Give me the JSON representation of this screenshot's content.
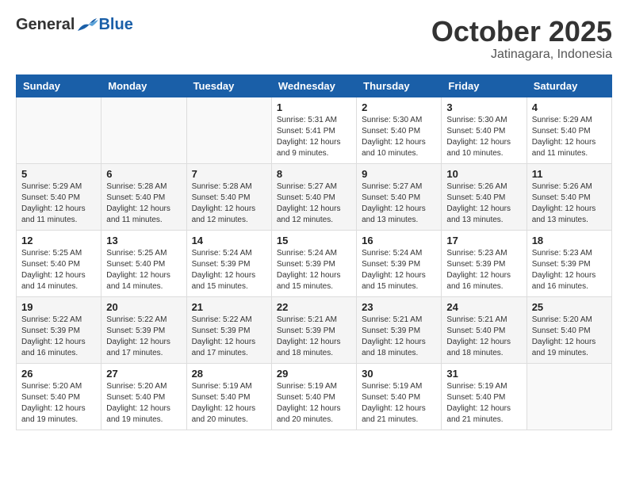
{
  "header": {
    "logo_general": "General",
    "logo_blue": "Blue",
    "month_title": "October 2025",
    "location": "Jatinagara, Indonesia"
  },
  "calendar": {
    "days_of_week": [
      "Sunday",
      "Monday",
      "Tuesday",
      "Wednesday",
      "Thursday",
      "Friday",
      "Saturday"
    ],
    "weeks": [
      [
        {
          "num": "",
          "info": ""
        },
        {
          "num": "",
          "info": ""
        },
        {
          "num": "",
          "info": ""
        },
        {
          "num": "1",
          "info": "Sunrise: 5:31 AM\nSunset: 5:41 PM\nDaylight: 12 hours\nand 9 minutes."
        },
        {
          "num": "2",
          "info": "Sunrise: 5:30 AM\nSunset: 5:40 PM\nDaylight: 12 hours\nand 10 minutes."
        },
        {
          "num": "3",
          "info": "Sunrise: 5:30 AM\nSunset: 5:40 PM\nDaylight: 12 hours\nand 10 minutes."
        },
        {
          "num": "4",
          "info": "Sunrise: 5:29 AM\nSunset: 5:40 PM\nDaylight: 12 hours\nand 11 minutes."
        }
      ],
      [
        {
          "num": "5",
          "info": "Sunrise: 5:29 AM\nSunset: 5:40 PM\nDaylight: 12 hours\nand 11 minutes."
        },
        {
          "num": "6",
          "info": "Sunrise: 5:28 AM\nSunset: 5:40 PM\nDaylight: 12 hours\nand 11 minutes."
        },
        {
          "num": "7",
          "info": "Sunrise: 5:28 AM\nSunset: 5:40 PM\nDaylight: 12 hours\nand 12 minutes."
        },
        {
          "num": "8",
          "info": "Sunrise: 5:27 AM\nSunset: 5:40 PM\nDaylight: 12 hours\nand 12 minutes."
        },
        {
          "num": "9",
          "info": "Sunrise: 5:27 AM\nSunset: 5:40 PM\nDaylight: 12 hours\nand 13 minutes."
        },
        {
          "num": "10",
          "info": "Sunrise: 5:26 AM\nSunset: 5:40 PM\nDaylight: 12 hours\nand 13 minutes."
        },
        {
          "num": "11",
          "info": "Sunrise: 5:26 AM\nSunset: 5:40 PM\nDaylight: 12 hours\nand 13 minutes."
        }
      ],
      [
        {
          "num": "12",
          "info": "Sunrise: 5:25 AM\nSunset: 5:40 PM\nDaylight: 12 hours\nand 14 minutes."
        },
        {
          "num": "13",
          "info": "Sunrise: 5:25 AM\nSunset: 5:40 PM\nDaylight: 12 hours\nand 14 minutes."
        },
        {
          "num": "14",
          "info": "Sunrise: 5:24 AM\nSunset: 5:39 PM\nDaylight: 12 hours\nand 15 minutes."
        },
        {
          "num": "15",
          "info": "Sunrise: 5:24 AM\nSunset: 5:39 PM\nDaylight: 12 hours\nand 15 minutes."
        },
        {
          "num": "16",
          "info": "Sunrise: 5:24 AM\nSunset: 5:39 PM\nDaylight: 12 hours\nand 15 minutes."
        },
        {
          "num": "17",
          "info": "Sunrise: 5:23 AM\nSunset: 5:39 PM\nDaylight: 12 hours\nand 16 minutes."
        },
        {
          "num": "18",
          "info": "Sunrise: 5:23 AM\nSunset: 5:39 PM\nDaylight: 12 hours\nand 16 minutes."
        }
      ],
      [
        {
          "num": "19",
          "info": "Sunrise: 5:22 AM\nSunset: 5:39 PM\nDaylight: 12 hours\nand 16 minutes."
        },
        {
          "num": "20",
          "info": "Sunrise: 5:22 AM\nSunset: 5:39 PM\nDaylight: 12 hours\nand 17 minutes."
        },
        {
          "num": "21",
          "info": "Sunrise: 5:22 AM\nSunset: 5:39 PM\nDaylight: 12 hours\nand 17 minutes."
        },
        {
          "num": "22",
          "info": "Sunrise: 5:21 AM\nSunset: 5:39 PM\nDaylight: 12 hours\nand 18 minutes."
        },
        {
          "num": "23",
          "info": "Sunrise: 5:21 AM\nSunset: 5:39 PM\nDaylight: 12 hours\nand 18 minutes."
        },
        {
          "num": "24",
          "info": "Sunrise: 5:21 AM\nSunset: 5:40 PM\nDaylight: 12 hours\nand 18 minutes."
        },
        {
          "num": "25",
          "info": "Sunrise: 5:20 AM\nSunset: 5:40 PM\nDaylight: 12 hours\nand 19 minutes."
        }
      ],
      [
        {
          "num": "26",
          "info": "Sunrise: 5:20 AM\nSunset: 5:40 PM\nDaylight: 12 hours\nand 19 minutes."
        },
        {
          "num": "27",
          "info": "Sunrise: 5:20 AM\nSunset: 5:40 PM\nDaylight: 12 hours\nand 19 minutes."
        },
        {
          "num": "28",
          "info": "Sunrise: 5:19 AM\nSunset: 5:40 PM\nDaylight: 12 hours\nand 20 minutes."
        },
        {
          "num": "29",
          "info": "Sunrise: 5:19 AM\nSunset: 5:40 PM\nDaylight: 12 hours\nand 20 minutes."
        },
        {
          "num": "30",
          "info": "Sunrise: 5:19 AM\nSunset: 5:40 PM\nDaylight: 12 hours\nand 21 minutes."
        },
        {
          "num": "31",
          "info": "Sunrise: 5:19 AM\nSunset: 5:40 PM\nDaylight: 12 hours\nand 21 minutes."
        },
        {
          "num": "",
          "info": ""
        }
      ]
    ]
  }
}
